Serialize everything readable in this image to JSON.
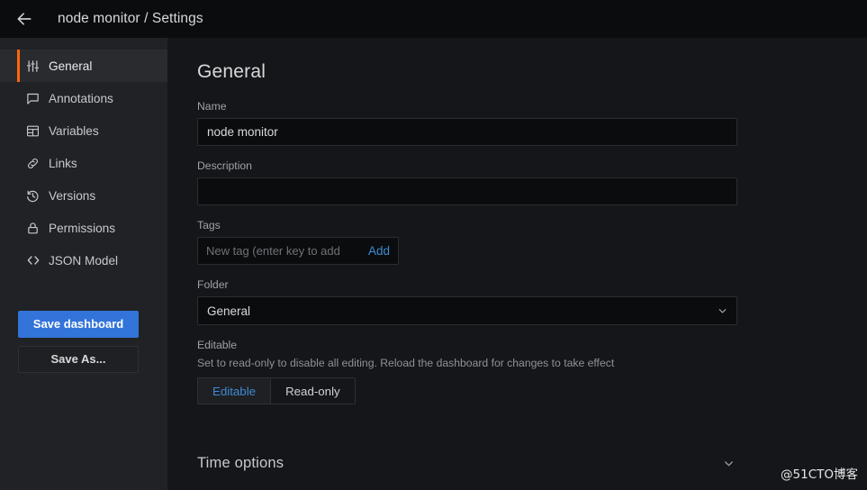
{
  "header": {
    "back_icon": "arrow-left-icon",
    "title": "node monitor / Settings"
  },
  "sidebar": {
    "items": [
      {
        "label": "General",
        "icon": "sliders-icon",
        "active": true
      },
      {
        "label": "Annotations",
        "icon": "comment-icon",
        "active": false
      },
      {
        "label": "Variables",
        "icon": "grid-icon",
        "active": false
      },
      {
        "label": "Links",
        "icon": "link-icon",
        "active": false
      },
      {
        "label": "Versions",
        "icon": "history-icon",
        "active": false
      },
      {
        "label": "Permissions",
        "icon": "lock-icon",
        "active": false
      },
      {
        "label": "JSON Model",
        "icon": "code-icon",
        "active": false
      }
    ],
    "save_dashboard_label": "Save dashboard",
    "save_as_label": "Save As..."
  },
  "main": {
    "title": "General",
    "name": {
      "label": "Name",
      "value": "node monitor"
    },
    "description": {
      "label": "Description",
      "value": "",
      "placeholder": ""
    },
    "tags": {
      "label": "Tags",
      "value": "",
      "placeholder": "New tag (enter key to add",
      "add_label": "Add"
    },
    "folder": {
      "label": "Folder",
      "value": "General",
      "chevron_icon": "chevron-down-icon"
    },
    "editable": {
      "label": "Editable",
      "help": "Set to read-only to disable all editing. Reload the dashboard for changes to take effect",
      "options": [
        "Editable",
        "Read-only"
      ],
      "selected": "Editable"
    },
    "time_options": {
      "title": "Time options",
      "chevron_icon": "chevron-down-icon",
      "expanded": false
    }
  },
  "watermark": {
    "text": "@51CTO博客"
  },
  "colors": {
    "accent_orange": "#ff660b",
    "primary_blue": "#3274d9",
    "link_blue": "#3d8bd4",
    "header_bg": "#0b0c0e",
    "sidebar_bg": "#212225",
    "content_bg": "#141619"
  }
}
